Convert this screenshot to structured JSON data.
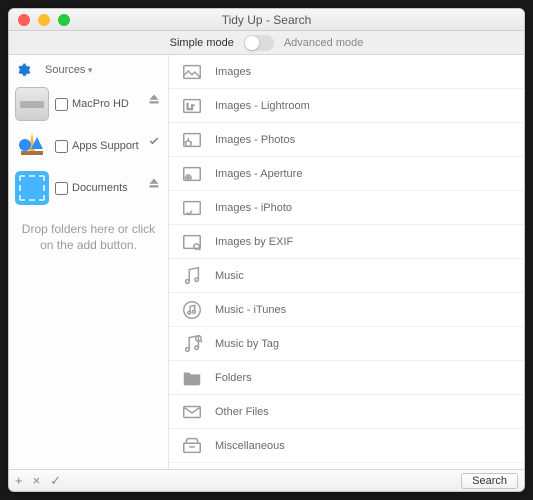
{
  "window": {
    "title": "Tidy Up - Search"
  },
  "modebar": {
    "simple": "Simple mode",
    "advanced": "Advanced mode"
  },
  "sidebar": {
    "sources_label": "Sources",
    "items": [
      {
        "label": "MacPro HD",
        "kind": "disk",
        "aux": "eject"
      },
      {
        "label": "Apps Support",
        "kind": "apps",
        "aux": "check"
      },
      {
        "label": "Documents",
        "kind": "docs",
        "aux": "eject"
      }
    ],
    "drop_hint": "Drop folders here or click on the add button."
  },
  "categories": [
    {
      "label": "Images",
      "icon": "image"
    },
    {
      "label": "Images - Lightroom",
      "icon": "lightroom"
    },
    {
      "label": "Images - Photos",
      "icon": "photos"
    },
    {
      "label": "Images - Aperture",
      "icon": "aperture"
    },
    {
      "label": "Images - iPhoto",
      "icon": "iphoto"
    },
    {
      "label": "Images by EXIF",
      "icon": "exif"
    },
    {
      "label": "Music",
      "icon": "music"
    },
    {
      "label": "Music - iTunes",
      "icon": "itunes"
    },
    {
      "label": "Music by Tag",
      "icon": "musictag"
    },
    {
      "label": "Folders",
      "icon": "folder"
    },
    {
      "label": "Other Files",
      "icon": "mail"
    },
    {
      "label": "Miscellaneous",
      "icon": "drawer"
    }
  ],
  "footer": {
    "search": "Search"
  }
}
